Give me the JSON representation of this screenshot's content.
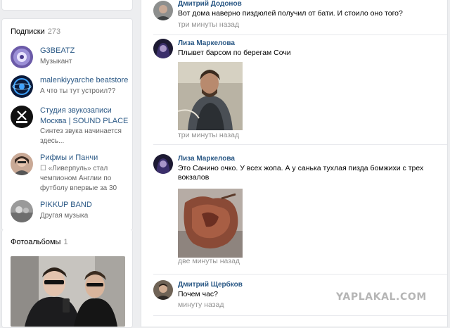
{
  "subscriptions": {
    "title": "Подписки",
    "count": "273",
    "items": [
      {
        "name": "G3BEATZ",
        "desc": "Музыкант"
      },
      {
        "name": "malenkiyyarche beatstore",
        "desc": "А что ты тут устроил??"
      },
      {
        "name": "Студия звукозаписи Москва | SOUND PLACE",
        "desc": "Синтез звука начинается здесь..."
      },
      {
        "name": "Рифмы и Панчи",
        "desc": "☐ «Ливерпуль» стал чемпионом Англии по футболу впервые за 30"
      },
      {
        "name": "PIKKUP BAND",
        "desc": "Другая музыка"
      }
    ]
  },
  "albums": {
    "title": "Фотоальбомы",
    "count": "1"
  },
  "comments": [
    {
      "author": "Дмитрий Додонов",
      "text": "Вот дома наверно пиздюлей получил от бати. И стоило оно того?",
      "time": "три минуты назад"
    },
    {
      "author": "Лиза Маркелова",
      "text": "Плывет барсом по берегам Сочи",
      "time": "три минуты назад"
    },
    {
      "author": "Лиза Маркелова",
      "text": "Это Санино очко. У всех жопа. А у санька тухлая пизда бомжихи с трех вокзалов",
      "time": "две минуты назад"
    },
    {
      "author": "Дмитрий Щербков",
      "text": "Почем час?",
      "time": "минуту назад"
    }
  ],
  "watermark": "YAPLAKAL.COM"
}
